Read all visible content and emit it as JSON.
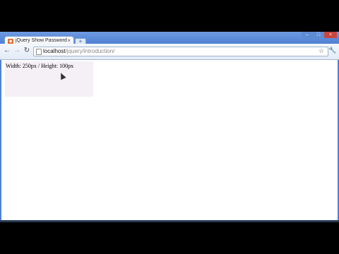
{
  "tab": {
    "title": "jQuery Show Password",
    "close": "×",
    "newtab": "+"
  },
  "window_controls": {
    "minimize": "–",
    "maximize": "□",
    "close": "×"
  },
  "nav": {
    "back": "←",
    "forward": "→",
    "reload": "↻"
  },
  "address": {
    "host": "localhost",
    "path": "/jquery/introduction/"
  },
  "icons": {
    "star": "☆",
    "wrench": "🔧"
  },
  "content": {
    "box_text": "Width: 250px / Height: 100px"
  },
  "colors": {
    "box_bg": "#f5eff6",
    "chrome_blue": "#4f80d4"
  }
}
